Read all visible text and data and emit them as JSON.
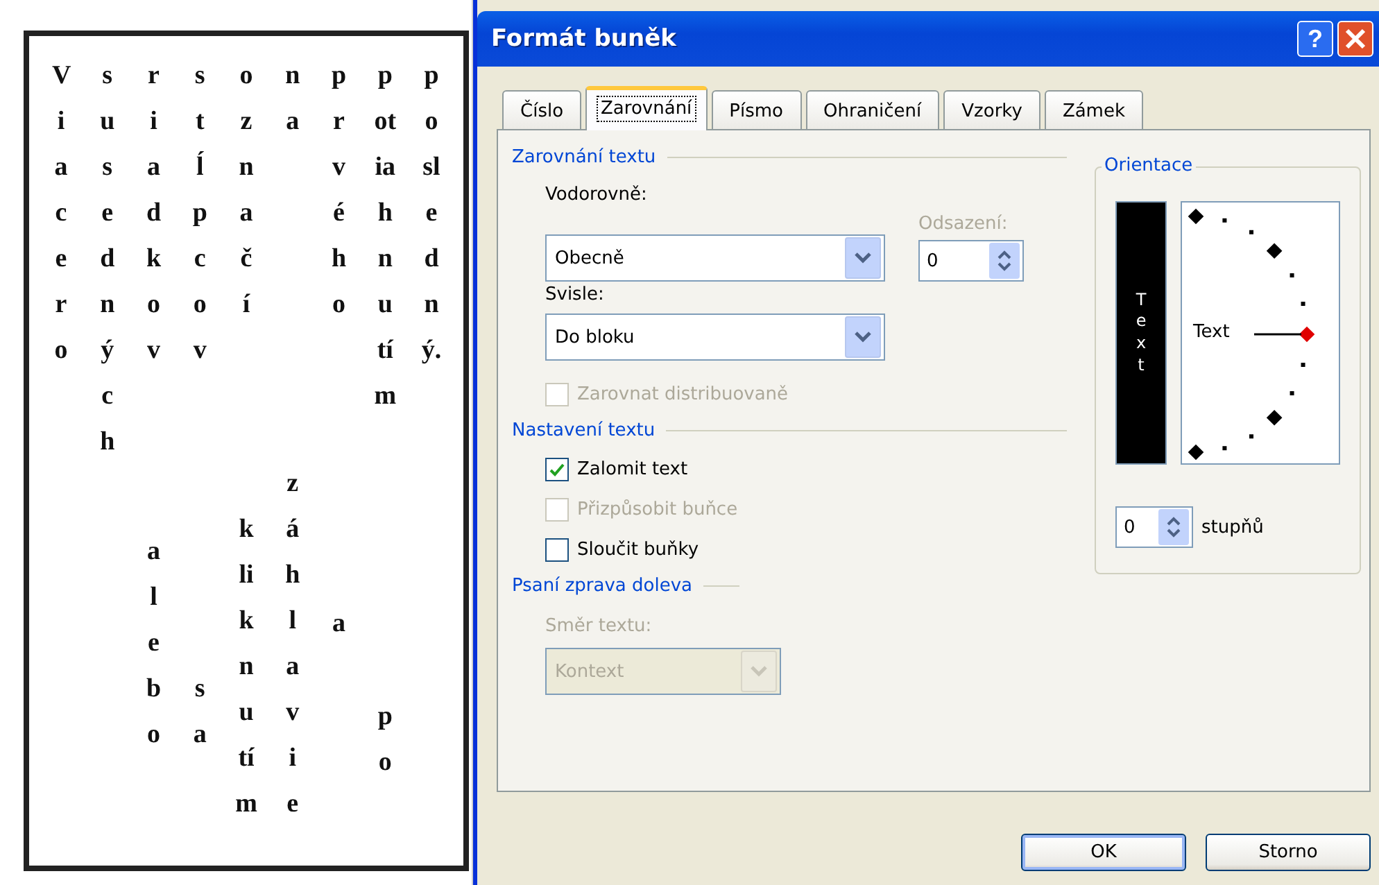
{
  "sheet": {
    "columns": [
      {
        "words": [
          "Viacero"
        ]
      },
      {
        "words": [
          "susedných"
        ]
      },
      {
        "words": [
          "riadkov",
          "alebo"
        ]
      },
      {
        "words": [
          "stĺpcov",
          "sa"
        ]
      },
      {
        "words": [
          "označí",
          "kliknutím"
        ]
      },
      {
        "words": [
          "na",
          "záhlavie"
        ]
      },
      {
        "words": [
          "prvého",
          "a"
        ]
      },
      {
        "words": [
          "potiahnutím",
          "po"
        ]
      },
      {
        "words": [
          "posledný."
        ]
      }
    ]
  },
  "dialog": {
    "title": "Formát buněk",
    "help_button": "?",
    "tabs": [
      {
        "label": "Číslo",
        "selected": false
      },
      {
        "label": "Zarovnání",
        "selected": true
      },
      {
        "label": "Písmo",
        "selected": false
      },
      {
        "label": "Ohraničení",
        "selected": false
      },
      {
        "label": "Vzorky",
        "selected": false
      },
      {
        "label": "Zámek",
        "selected": false
      }
    ],
    "alignment": {
      "title": "Zarovnání textu",
      "horizontal_label": "Vodorovně:",
      "horizontal_value": "Obecně",
      "vertical_label": "Svisle:",
      "vertical_value": "Do bloku",
      "indent_label": "Odsazení:",
      "indent_value": "0",
      "indent_disabled": true,
      "distribute": {
        "label": "Zarovnat distribuovaně",
        "checked": false,
        "disabled": true
      }
    },
    "text_control": {
      "title": "Nastavení textu",
      "options": [
        {
          "label": "Zalomit text",
          "checked": true,
          "disabled": false
        },
        {
          "label": "Přizpůsobit buňce",
          "checked": false,
          "disabled": true
        },
        {
          "label": "Sloučit buňky",
          "checked": false,
          "disabled": false
        }
      ]
    },
    "right_to_left": {
      "title": "Psaní zprava doleva",
      "direction_label": "Směr textu:",
      "direction_value": "Kontext",
      "disabled": true
    },
    "orientation": {
      "title": "Orientace",
      "vertical_text": "Text",
      "vertical_selected": true,
      "dial_label": "Text",
      "degrees_value": "0",
      "degrees_label": "stupňů"
    },
    "buttons": [
      {
        "label": "OK",
        "default": true
      },
      {
        "label": "Storno",
        "default": false
      }
    ]
  }
}
